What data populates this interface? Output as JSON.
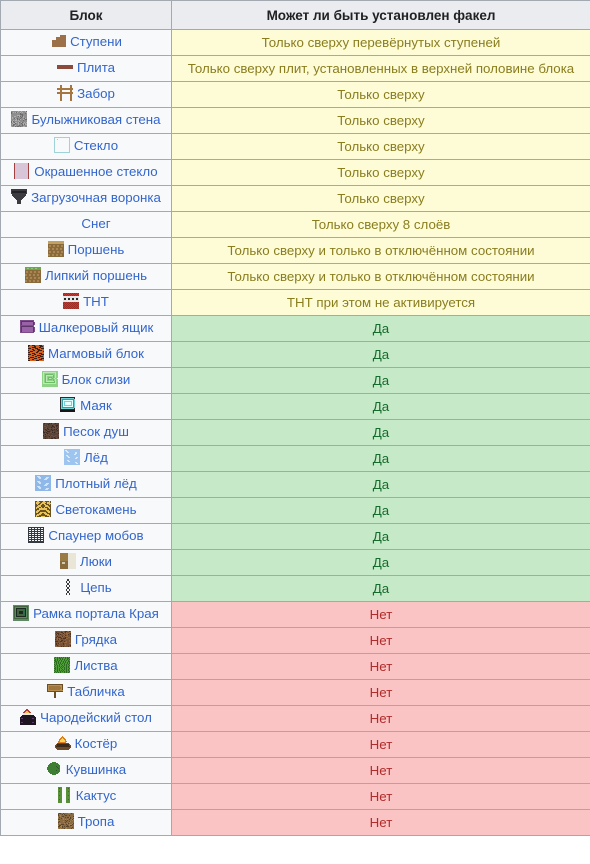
{
  "table": {
    "headers": {
      "block": "Блок",
      "answer": "Может ли быть установлен факел"
    },
    "colors": {
      "header_bg": "#eaecf0",
      "border": "#a2a9b1",
      "block_cell_bg": "#f8f9fa",
      "link": "#3366cc",
      "partial_bg": "#fdfcd7",
      "partial_text": "#8a7d1e",
      "yes_bg": "#c6e9c8",
      "yes_text": "#156b2c",
      "no_bg": "#fbc4c4",
      "no_text": "#b02b2b"
    },
    "rows": [
      {
        "icon": "stairs-icon",
        "block": "Ступени",
        "answer": "Только сверху перевёрнутых ступеней",
        "state": "partial"
      },
      {
        "icon": "slab-icon",
        "block": "Плита",
        "answer": "Только сверху плит, установленных в верхней половине блока",
        "state": "partial"
      },
      {
        "icon": "fence-icon",
        "block": "Забор",
        "answer": "Только сверху",
        "state": "partial"
      },
      {
        "icon": "cobblestone-wall-icon",
        "block": "Булыжниковая стена",
        "answer": "Только сверху",
        "state": "partial"
      },
      {
        "icon": "glass-icon",
        "block": "Стекло",
        "answer": "Только сверху",
        "state": "partial"
      },
      {
        "icon": "stained-glass-icon",
        "block": "Окрашенное стекло",
        "answer": "Только сверху",
        "state": "partial"
      },
      {
        "icon": "hopper-icon",
        "block": "Загрузочная воронка",
        "answer": "Только сверху",
        "state": "partial"
      },
      {
        "icon": "none",
        "block": "Снег",
        "answer": "Только сверху 8 слоёв",
        "state": "partial"
      },
      {
        "icon": "piston-icon",
        "block": "Поршень",
        "answer": "Только сверху и только в отключённом состоянии",
        "state": "partial"
      },
      {
        "icon": "sticky-piston-icon",
        "block": "Липкий поршень",
        "answer": "Только сверху и только в отключённом состоянии",
        "state": "partial"
      },
      {
        "icon": "tnt-icon",
        "block": "ТНТ",
        "answer": "ТНТ при этом не активируется",
        "state": "partial"
      },
      {
        "icon": "shulker-box-icon",
        "block": "Шалкеровый ящик",
        "answer": "Да",
        "state": "yes"
      },
      {
        "icon": "magma-block-icon",
        "block": "Магмовый блок",
        "answer": "Да",
        "state": "yes"
      },
      {
        "icon": "slime-block-icon",
        "block": "Блок слизи",
        "answer": "Да",
        "state": "yes"
      },
      {
        "icon": "beacon-icon",
        "block": "Маяк",
        "answer": "Да",
        "state": "yes"
      },
      {
        "icon": "soul-sand-icon",
        "block": "Песок душ",
        "answer": "Да",
        "state": "yes"
      },
      {
        "icon": "ice-icon",
        "block": "Лёд",
        "answer": "Да",
        "state": "yes"
      },
      {
        "icon": "packed-ice-icon",
        "block": "Плотный лёд",
        "answer": "Да",
        "state": "yes"
      },
      {
        "icon": "glowstone-icon",
        "block": "Светокамень",
        "answer": "Да",
        "state": "yes"
      },
      {
        "icon": "mob-spawner-icon",
        "block": "Спаунер мобов",
        "answer": "Да",
        "state": "yes"
      },
      {
        "icon": "trapdoor-icon",
        "block": "Люки",
        "answer": "Да",
        "state": "yes"
      },
      {
        "icon": "chain-icon",
        "block": "Цепь",
        "answer": "Да",
        "state": "yes"
      },
      {
        "icon": "end-portal-frame-icon",
        "block": "Рамка портала Края",
        "answer": "Нет",
        "state": "no"
      },
      {
        "icon": "farmland-icon",
        "block": "Грядка",
        "answer": "Нет",
        "state": "no"
      },
      {
        "icon": "leaves-icon",
        "block": "Листва",
        "answer": "Нет",
        "state": "no"
      },
      {
        "icon": "sign-icon",
        "block": "Табличка",
        "answer": "Нет",
        "state": "no"
      },
      {
        "icon": "enchanting-table-icon",
        "block": "Чародейский стол",
        "answer": "Нет",
        "state": "no"
      },
      {
        "icon": "campfire-icon",
        "block": "Костёр",
        "answer": "Нет",
        "state": "no"
      },
      {
        "icon": "lily-pad-icon",
        "block": "Кувшинка",
        "answer": "Нет",
        "state": "no"
      },
      {
        "icon": "cactus-icon",
        "block": "Кактус",
        "answer": "Нет",
        "state": "no"
      },
      {
        "icon": "dirt-path-icon",
        "block": "Тропа",
        "answer": "Нет",
        "state": "no"
      }
    ]
  }
}
